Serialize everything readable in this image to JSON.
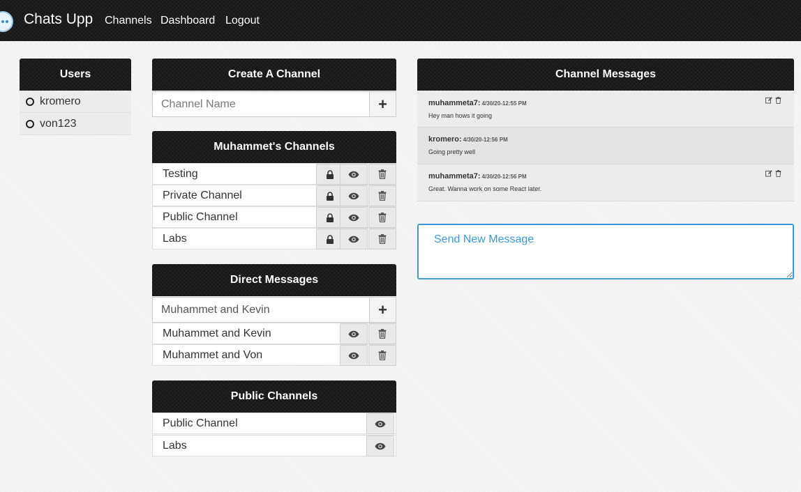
{
  "app": {
    "brand": "Chats Upp",
    "nav": [
      "Channels",
      "Dashboard",
      "Logout"
    ]
  },
  "users": {
    "title": "Users",
    "items": [
      "kromero",
      "von123"
    ]
  },
  "create_channel": {
    "title": "Create A Channel",
    "placeholder": "Channel Name",
    "add_label": "+"
  },
  "my_channels": {
    "title": "Muhammet's Channels",
    "items": [
      "Testing",
      "Private Channel",
      "Public Channel",
      "Labs"
    ]
  },
  "direct_messages": {
    "title": "Direct Messages",
    "input_value": "Muhammet and Kevin",
    "add_label": "+",
    "items": [
      "Muhammet and Kevin",
      "Muhammet and Von"
    ]
  },
  "public_channels": {
    "title": "Public Channels",
    "items": [
      "Public Channel",
      "Labs"
    ]
  },
  "channel_messages": {
    "title": "Channel Messages",
    "messages": [
      {
        "author": "muhammeta7:",
        "time": "4/30/20-12:55 PM",
        "text": "Hey man hows it going",
        "editable": true
      },
      {
        "author": "kromero:",
        "time": "4/30/20-12:56 PM",
        "text": "Going pretty well",
        "editable": false
      },
      {
        "author": "muhammeta7:",
        "time": "4/30/20-12:56 PM",
        "text": "Great. Wanna work on some React later.",
        "editable": true
      }
    ]
  },
  "composer": {
    "placeholder": "Send New Message"
  },
  "icons": {
    "lock": "lock-icon",
    "view": "eye-icon",
    "delete": "trash-icon",
    "edit": "edit-icon",
    "status": "circle-outline-icon",
    "logo": "chat-bubble-icon"
  },
  "colors": {
    "header_bg": "#1c1c1c",
    "accent": "#3a9ad9",
    "page_bg": "#f4f4f4"
  }
}
